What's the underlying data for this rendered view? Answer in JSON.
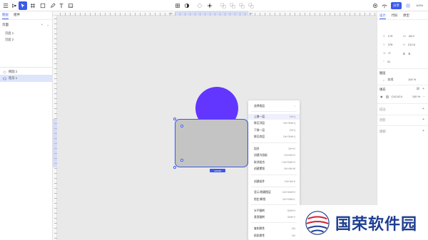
{
  "toolbar": {
    "share_label": "分享",
    "zoom_label": "100%",
    "accent_color": "#3c5ae6"
  },
  "left_panel": {
    "tabs": [
      "图层",
      "组件"
    ],
    "section_title": "页面",
    "pages": [
      "页面 1",
      "页面 2"
    ],
    "layers": [
      "椭圆 2",
      "矩形 1"
    ]
  },
  "ruler": {
    "top_start": "175",
    "top_end": "393"
  },
  "canvas": {
    "size_tag": "103x68",
    "circle_color": "#6236ff",
    "rect_color": "#c4c4c4"
  },
  "context_menu": {
    "items": [
      {
        "label": "选择图层",
        "shortcut": "›"
      },
      {
        "label": "上移一层",
        "shortcut": "Ctrl+]"
      },
      {
        "label": "移至顶层",
        "shortcut": "Ctrl+Shift+]"
      },
      {
        "label": "下移一层",
        "shortcut": "Ctrl+["
      },
      {
        "label": "移至底层",
        "shortcut": "Ctrl+Shift+["
      },
      {
        "label": "组合",
        "shortcut": "Ctrl+G"
      },
      {
        "label": "创建为画板",
        "shortcut": "Ctrl+Alt+G"
      },
      {
        "label": "取消组合",
        "shortcut": "Ctrl+Shift+G"
      },
      {
        "label": "创建蒙版",
        "shortcut": "Ctrl+Alt+M"
      },
      {
        "label": "创建组件",
        "shortcut": "Ctrl+Alt+K"
      },
      {
        "label": "显示/隐藏图层",
        "shortcut": "Ctrl+Shift+H"
      },
      {
        "label": "锁定/解锁",
        "shortcut": "Ctrl+Shift+L"
      },
      {
        "label": "水平翻转",
        "shortcut": "Shift+H"
      },
      {
        "label": "垂直翻转",
        "shortcut": "Shift+V"
      },
      {
        "label": "复制属性",
        "shortcut": "Ctrl"
      },
      {
        "label": "粘贴属性",
        "shortcut": "Ctrl"
      }
    ]
  },
  "right_panel": {
    "tabs": [
      "设计",
      "代码",
      "原型"
    ],
    "x": "175",
    "y": "378",
    "w": "28.9",
    "h": "212.6",
    "rotation": "0°",
    "radius": "31",
    "layer_title": "图层",
    "blend": "穿透",
    "opacity": "100 %",
    "fill_title": "填充",
    "fill_hex": "C4C4C4",
    "fill_opacity": "100 %",
    "stroke_title": "描边",
    "shadow_title": "阴影",
    "blur_title": "模糊"
  },
  "watermark": {
    "text": "国荣软件园"
  }
}
